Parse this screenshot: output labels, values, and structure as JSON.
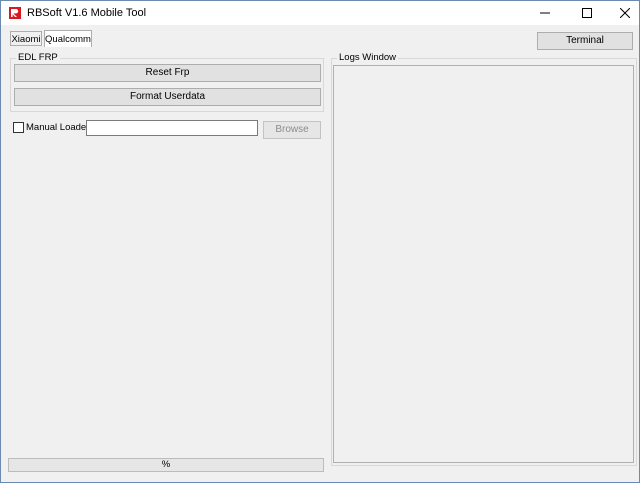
{
  "window": {
    "title": "RBSoft V1.6 Mobile Tool",
    "app_icon": "rbsoft-logo-icon",
    "controls": {
      "minimize": "minimize-icon",
      "maximize": "maximize-icon",
      "close": "close-icon"
    }
  },
  "tabs": [
    {
      "label": "Xiaomi",
      "selected": false
    },
    {
      "label": "Qualcomm",
      "selected": true
    }
  ],
  "toolbar": {
    "terminal_label": "Terminal"
  },
  "edl_frp": {
    "title": "EDL FRP",
    "reset_frp_label": "Reset Frp",
    "format_userdata_label": "Format Userdata"
  },
  "manual_loader": {
    "label": "Manual Loader",
    "checked": false,
    "path_value": "",
    "browse_label": "Browse",
    "browse_enabled": false
  },
  "logs": {
    "title": "Logs Window"
  },
  "progress": {
    "text": "%",
    "value": 0
  },
  "colors": {
    "accent": "#d71920",
    "window_bg": "#f0f0f0",
    "progress_fill": "#06b025"
  }
}
